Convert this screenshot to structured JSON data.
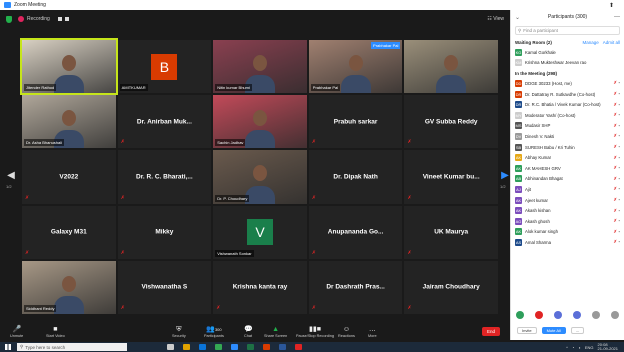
{
  "os": {
    "window_title": "Zoom Meeting"
  },
  "meeting": {
    "recording_label": "Recording",
    "view_label": "View"
  },
  "gallery": {
    "page_left": "1/2",
    "page_right": "1/2",
    "tiles": [
      {
        "name": "Jitender Rathod",
        "label": "",
        "type": "video"
      },
      {
        "name": "AMITKUMAR",
        "label": "",
        "type": "avatar",
        "letter": "B",
        "color": "#d83b01"
      },
      {
        "name": "Nitin kumar Bhumi",
        "label": "",
        "type": "video"
      },
      {
        "name": "Prabhakar Pal",
        "label": "",
        "type": "video",
        "speaking": "Prabhakar Pal"
      },
      {
        "name": "",
        "label": "",
        "type": "video"
      },
      {
        "name": "Dr. Asha Bhanushali",
        "label": "",
        "type": "video"
      },
      {
        "name": "",
        "label": "Dr. Anirban Muk...",
        "type": "text"
      },
      {
        "name": "Sachin Jadhav",
        "label": "",
        "type": "video"
      },
      {
        "name": "",
        "label": "Prabuh sarkar",
        "type": "text"
      },
      {
        "name": "",
        "label": "GV Subba Reddy",
        "type": "text"
      },
      {
        "name": "",
        "label": "V2022",
        "type": "text"
      },
      {
        "name": "",
        "label": "Dr. R. C. Bharati,...",
        "type": "text"
      },
      {
        "name": "Dr. P. Choudhary",
        "label": "",
        "type": "video"
      },
      {
        "name": "",
        "label": "Dr. Dipak Nath",
        "type": "text"
      },
      {
        "name": "",
        "label": "Vineet Kumar bu...",
        "type": "text"
      },
      {
        "name": "",
        "label": "Galaxy M31",
        "type": "text"
      },
      {
        "name": "",
        "label": "Mikky",
        "type": "text"
      },
      {
        "name": "Vishwanath Sonkar",
        "label": "",
        "type": "avatar",
        "letter": "V",
        "color": "#1a7f4b"
      },
      {
        "name": "",
        "label": "Anupananda  Go...",
        "type": "text"
      },
      {
        "name": "",
        "label": "UK Maurya",
        "type": "text"
      },
      {
        "name": "Siddhant Reddy",
        "label": "",
        "type": "video"
      },
      {
        "name": "",
        "label": "Vishwanatha S",
        "type": "text"
      },
      {
        "name": "",
        "label": "Krishna kanta ray",
        "type": "text"
      },
      {
        "name": "",
        "label": "Dr Dashrath Pras...",
        "type": "text"
      },
      {
        "name": "",
        "label": "Jairam Choudhary",
        "type": "text"
      }
    ]
  },
  "panel": {
    "title": "Participants (300)",
    "search_placeholder": "Find a participant",
    "waiting_label": "Waiting Room (2)",
    "manage_label": "Manage",
    "admit_label": "Admit all",
    "in_meeting_label": "In the Meeting (298)",
    "waiting": [
      {
        "name": "Kamal Gorkhale",
        "initials": "KG",
        "color": "#2e9e5b"
      },
      {
        "name": "Krishna Mukteshwar Jeevan rao",
        "initials": "KM",
        "color": "#ccc"
      }
    ],
    "participants": [
      {
        "name": "DDGE 30233 (Host, me)",
        "initials": "DD",
        "color": "#d83b01"
      },
      {
        "name": "Dr. Dattatray R. Sutkavdhe (Co-host)",
        "initials": "DR",
        "color": "#d83b01"
      },
      {
        "name": "Dr. R.C. Bhatia / Vivek Kumar (Co-host)",
        "initials": "DR",
        "color": "#1c4a8a"
      },
      {
        "name": "Moderator Yash/ (Co-host)",
        "initials": "MY",
        "color": "#ccc"
      },
      {
        "name": "Mudasir SHP",
        "initials": "MS",
        "color": "#555"
      },
      {
        "name": "Dinesh V. Nakti",
        "initials": "DV",
        "color": "#999"
      },
      {
        "name": "SURESH Babu / Kri Tuhin",
        "initials": "SB",
        "color": "#555"
      },
      {
        "name": "Abhay Kumar",
        "initials": "AK",
        "color": "#e6a817"
      },
      {
        "name": "AK MAHESH GRV",
        "initials": "AK",
        "color": "#2e9e5b"
      },
      {
        "name": "Abhinandan Bhagat",
        "initials": "AB",
        "color": "#2e9e5b"
      },
      {
        "name": "Ajit",
        "initials": "AJ",
        "color": "#7b4dbc"
      },
      {
        "name": "Ajeet kumar",
        "initials": "AK",
        "color": "#7b4dbc"
      },
      {
        "name": "Akash kishan",
        "initials": "AK",
        "color": "#7b4dbc"
      },
      {
        "name": "Akash ghosh",
        "initials": "AG",
        "color": "#7b4dbc"
      },
      {
        "name": "Alok kumar singh",
        "initials": "AK",
        "color": "#2e9e5b"
      },
      {
        "name": "Amal Sharma",
        "initials": "AS",
        "color": "#1c4a8a"
      }
    ],
    "invite_label": "Invite",
    "mute_all_label": "Mute All",
    "more_label": "..."
  },
  "toolbar": {
    "unmute": "Unmute",
    "start_video": "Start Video",
    "security": "Security",
    "participants": "Participants",
    "participants_count": "300",
    "chat": "Chat",
    "share_screen": "Share Screen",
    "pause_recording": "Pause/Stop Recording",
    "reactions": "Reactions",
    "more": "More",
    "end": "End"
  },
  "taskbar": {
    "search_placeholder": "Type here to search",
    "time": "20:08",
    "date": "21-09-2021",
    "lang": "ENG"
  }
}
